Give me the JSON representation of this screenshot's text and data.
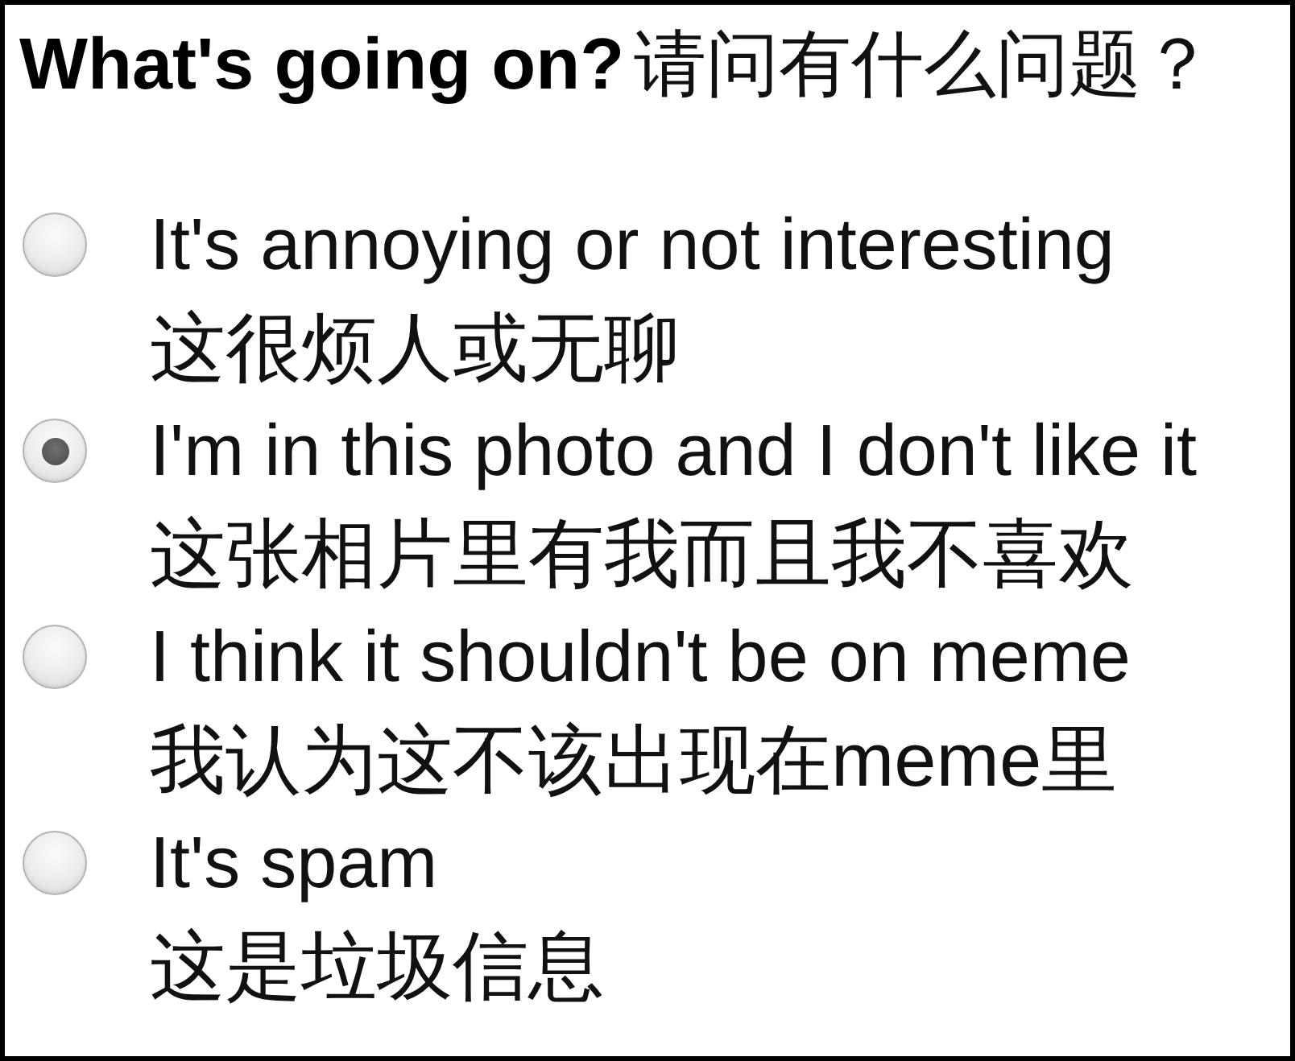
{
  "question": {
    "title": "**What's going on?**请问有什么问题？"
  },
  "options": [
    {
      "label": "It's annoying or not interesting",
      "translation": "这很烦人或无聊",
      "selected": false
    },
    {
      "label": "I'm in this photo and I don't like it",
      "translation": "这张相片里有我而且我不喜欢",
      "selected": true
    },
    {
      "label": "I think it shouldn't be on meme",
      "translation": "我认为这不该出现在meme里",
      "selected": false
    },
    {
      "label": "It's spam",
      "translation": "这是垃圾信息",
      "selected": false
    }
  ]
}
